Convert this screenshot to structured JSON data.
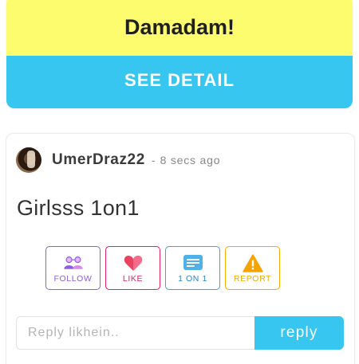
{
  "promo": {
    "title": "Damadam!",
    "button_label": "SEE DETAIL",
    "colors": {
      "banner": "#fdfb6e",
      "button": "#37c6ef"
    }
  },
  "post": {
    "username": "UmerDraz22",
    "separator": "-",
    "time": "8 secs ago",
    "text": "Girlsss 1on1",
    "actions": [
      {
        "label": "FOLLOW",
        "icon": "follow-icon",
        "color": "#8d5fe0"
      },
      {
        "label": "LIKE",
        "icon": "heart-icon",
        "color": "#e51c67"
      },
      {
        "label": "1 ON 1",
        "icon": "chat-icon",
        "color": "#3aa5e2"
      },
      {
        "label": "REPORT",
        "icon": "warning-icon",
        "color": "#f2a900"
      }
    ]
  },
  "reply": {
    "placeholder": "Reply likhein..",
    "button_label": "reply"
  }
}
